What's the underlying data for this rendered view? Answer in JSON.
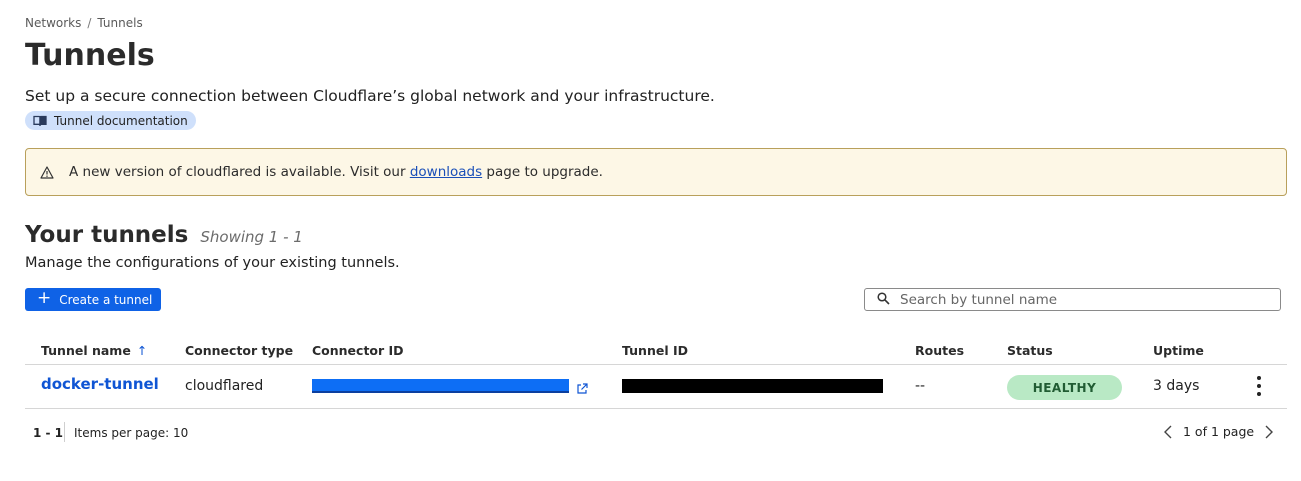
{
  "breadcrumb": {
    "items": [
      "Networks",
      "Tunnels"
    ],
    "separator": "/"
  },
  "page": {
    "title": "Tunnels",
    "description": "Set up a secure connection between Cloudflare’s global network and your infrastructure.",
    "doc_link": {
      "label": "Tunnel documentation",
      "icon": "book-icon"
    }
  },
  "banner": {
    "icon": "warning-icon",
    "text_before": "A new version of cloudflared is available. Visit our ",
    "link": "downloads",
    "text_after": " page to upgrade."
  },
  "tunnels_section": {
    "title": "Your tunnels",
    "showing": "Showing 1 - 1",
    "description": "Manage the configurations of your existing tunnels.",
    "create_button": "Create a tunnel",
    "search_placeholder": "Search by tunnel name"
  },
  "table": {
    "columns": [
      "Tunnel name",
      "Connector type",
      "Connector ID",
      "Tunnel ID",
      "Routes",
      "Status",
      "Uptime"
    ],
    "sort_indicator": "↑",
    "rows": [
      {
        "tunnel_name": "docker-tunnel",
        "connector_type": "cloudflared",
        "routes": "--",
        "status": "HEALTHY",
        "uptime": "3 days"
      }
    ]
  },
  "footer": {
    "range": "1 - 1",
    "items_per_page": "Items per page: 10",
    "page_label": "1 of 1 page"
  },
  "colors": {
    "accent": "#0f62e6",
    "link": "#0f55d4",
    "banner_bg": "#fdf7e6",
    "banner_border": "#b9a05b",
    "healthy_bg": "#b9e9c5",
    "healthy_text": "#215c33",
    "doc_pill_bg": "#cfe0fb"
  }
}
